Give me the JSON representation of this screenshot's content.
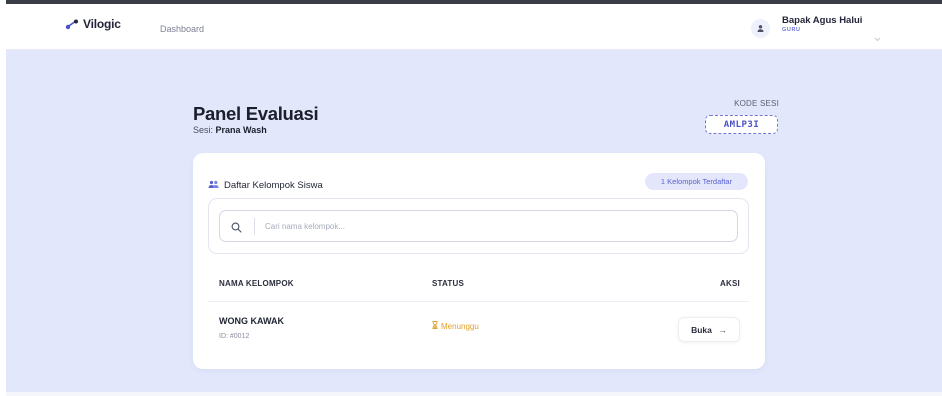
{
  "app": {
    "brand": "Vilogic",
    "nav_link": "Dashboard"
  },
  "user": {
    "name": "Bapak Agus Halui",
    "role": "GURU",
    "avatar_icon": "user-icon"
  },
  "page": {
    "title": "Panel Evaluasi",
    "session_label": "Sesi:",
    "session_name": "Prana Wash"
  },
  "session_code": {
    "label": "KODE SESI",
    "value": "AMLP3I"
  },
  "card": {
    "title": "Daftar Kelompok Siswa",
    "title_icon": "users-icon",
    "badge": "1 Kelompok Terdaftar",
    "search": {
      "placeholder": "Cari nama kelompok...",
      "value": ""
    },
    "table": {
      "headers": {
        "name": "NAMA KELOMPOK",
        "status": "STATUS",
        "action": "AKSI"
      },
      "rows": [
        {
          "name": "WONG KAWAK",
          "id": "ID: #0012",
          "status": "Menunggu",
          "status_icon": "hourglass-icon",
          "action_label": "Buka",
          "action_icon": "arrow-right-icon"
        }
      ]
    }
  },
  "colors": {
    "accent": "#5a62d0",
    "background": "#e2e7fb",
    "status_waiting": "#e2a12c"
  }
}
